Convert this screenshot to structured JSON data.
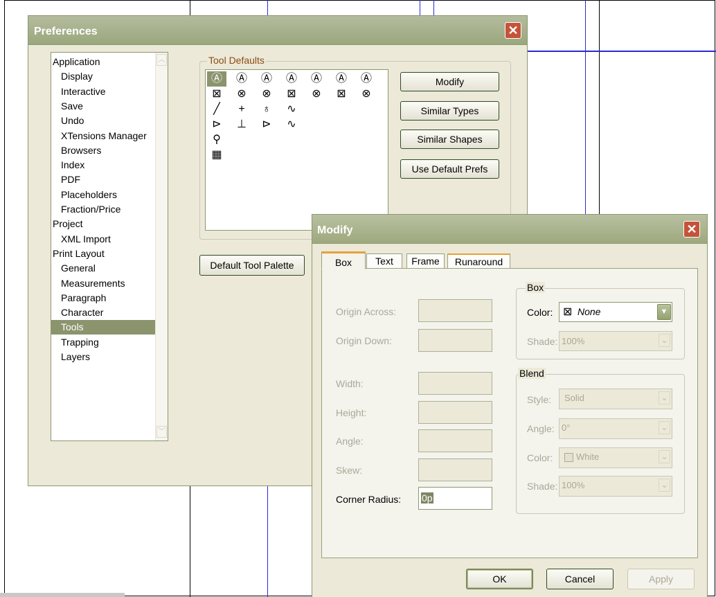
{
  "preferences": {
    "title": "Preferences",
    "close_glyph": "✕",
    "tree": [
      {
        "label": "Application",
        "level": 0
      },
      {
        "label": "Display",
        "level": 1
      },
      {
        "label": "Interactive",
        "level": 1
      },
      {
        "label": "Save",
        "level": 1
      },
      {
        "label": "Undo",
        "level": 1
      },
      {
        "label": "XTensions Manager",
        "level": 1
      },
      {
        "label": "Browsers",
        "level": 1
      },
      {
        "label": "Index",
        "level": 1
      },
      {
        "label": "PDF",
        "level": 1
      },
      {
        "label": "Placeholders",
        "level": 1
      },
      {
        "label": "Fraction/Price",
        "level": 1
      },
      {
        "label": "Project",
        "level": 0
      },
      {
        "label": "XML Import",
        "level": 1
      },
      {
        "label": "Print Layout",
        "level": 0
      },
      {
        "label": "General",
        "level": 1
      },
      {
        "label": "Measurements",
        "level": 1
      },
      {
        "label": "Paragraph",
        "level": 1
      },
      {
        "label": "Character",
        "level": 1
      },
      {
        "label": "Tools",
        "level": 1,
        "selected": true
      },
      {
        "label": "Trapping",
        "level": 1
      },
      {
        "label": "Layers",
        "level": 1
      }
    ],
    "tool_defaults_label": "Tool Defaults",
    "tool_icon_rows": [
      [
        "text-box-icon",
        "text-box-rounded-icon",
        "text-box-beveled-icon",
        "text-box-concave-icon",
        "text-box-oval-icon",
        "text-box-bezier-icon",
        "text-box-freehand-icon"
      ],
      [
        "picture-box-icon",
        "picture-box-rounded-icon",
        "picture-box-beveled-icon",
        "picture-box-concave-icon",
        "picture-box-oval-icon",
        "picture-box-bezier-icon",
        "picture-box-freehand-icon"
      ],
      [
        "line-icon",
        "orthogonal-line-icon",
        "bezier-line-icon",
        "freehand-line-icon"
      ],
      [
        "text-path-icon",
        "orthogonal-text-path-icon",
        "bezier-text-path-icon",
        "freehand-text-path-icon"
      ],
      [
        "zoom-icon"
      ],
      [
        "table-icon"
      ]
    ],
    "buttons": {
      "modify": "Modify",
      "similar_types": "Similar Types",
      "similar_shapes": "Similar Shapes",
      "use_default_prefs": "Use Default Prefs",
      "default_tool_palette": "Default Tool Palette"
    }
  },
  "modify": {
    "title": "Modify",
    "close_glyph": "✕",
    "tabs": [
      "Box",
      "Text",
      "Frame",
      "Runaround"
    ],
    "active_tab": "Box",
    "fields": {
      "origin_across": "Origin Across:",
      "origin_down": "Origin Down:",
      "width": "Width:",
      "height": "Height:",
      "angle": "Angle:",
      "skew": "Skew:",
      "corner_radius": "Corner Radius:",
      "corner_radius_value": "0p"
    },
    "box_group": {
      "legend": "Box",
      "color_label": "Color:",
      "color_value": "None",
      "shade_label": "Shade:",
      "shade_value": "100%"
    },
    "blend_group": {
      "legend": "Blend",
      "style_label": "Style:",
      "style_value": "Solid",
      "angle_label": "Angle:",
      "angle_value": "0°",
      "color_label": "Color:",
      "color_value": "White",
      "shade_label": "Shade:",
      "shade_value": "100%"
    },
    "buttons": {
      "ok": "OK",
      "cancel": "Cancel",
      "apply": "Apply"
    }
  }
}
